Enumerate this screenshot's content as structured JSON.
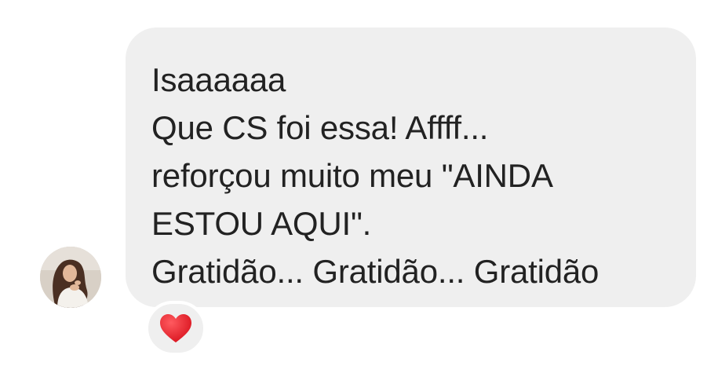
{
  "message": {
    "lines": [
      "Isaaaaaa",
      "Que CS foi essa! Affff...",
      "reforçou muito meu \"AINDA",
      "ESTOU AQUI\".",
      "Gratidão... Gratidão... Gratidão"
    ]
  },
  "reaction": {
    "icon": "heart-icon",
    "color": "#e0202a"
  },
  "colors": {
    "bubble_background": "#efefef",
    "text": "#222222"
  }
}
